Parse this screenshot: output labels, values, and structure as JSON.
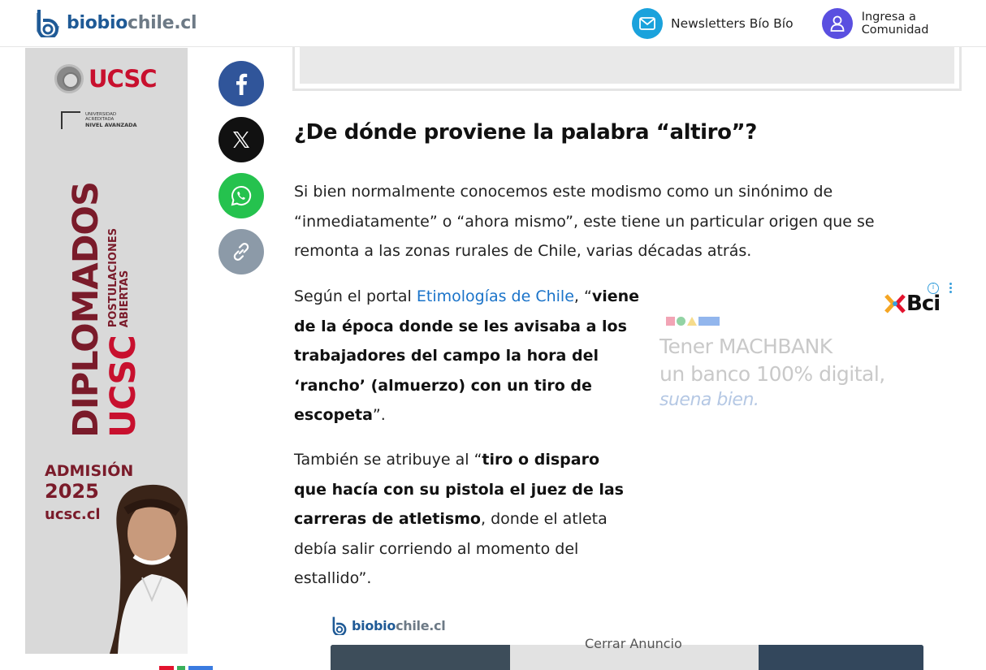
{
  "header": {
    "logo_part1": "biobio",
    "logo_part2": "chile.cl",
    "newsletters_label": "Newsletters Bío Bío",
    "community_label": "Ingresa a Comunidad"
  },
  "left_ad": {
    "brand": "UCSC",
    "accreditation_line1": "UNIVERSIDAD ACREDITADA",
    "accreditation_line2": "NIVEL AVANZADA",
    "headline": "DIPLOMADOS",
    "brand_vertical": "UCSC",
    "postulaciones_1": "POSTULACIONES",
    "postulaciones_2": "ABIERTAS",
    "admision": "ADMISIÓN",
    "year": "2025",
    "website": "ucsc.cl"
  },
  "share": {
    "items": [
      {
        "name": "facebook-icon"
      },
      {
        "name": "x-icon"
      },
      {
        "name": "whatsapp-icon"
      },
      {
        "name": "link-icon"
      }
    ]
  },
  "article": {
    "heading": "¿De dónde proviene la palabra “altiro”?",
    "p1": "Si bien normalmente conocemos este modismo como un sinónimo de “inmediatamente” o “ahora mismo”, este tiene un particular origen que se remonta a las zonas rurales de Chile, varias décadas atrás.",
    "p2_pre": "Según el portal ",
    "p2_link": "Etimologías de Chile",
    "p2_mid": ", “",
    "p2_bold": "viene de la época donde se les avisaba a los trabajadores del campo la hora del ‘rancho’ (almuerzo) con un tiro de escopeta",
    "p2_end": "”.",
    "p3_pre": "También se atribuye al “",
    "p3_bold": "tiro o disparo que hacía con su pistola el juez de las carreras de atletismo",
    "p3_end": ", donde el atleta debía salir corriendo al momento del estallido”."
  },
  "bci_ad": {
    "brand": "Bci",
    "line1": "Tener MACHBANK",
    "line2": "un banco 100% digital,",
    "line3": "suena bien."
  },
  "video": {
    "logo_part1": "biobio",
    "logo_part2": "chile.cl",
    "close_label": "Cerrar Anuncio"
  },
  "colors": {
    "brand_blue": "#1f5a96",
    "link_blue": "#1a73c9",
    "newsletter_circle": "#1aa2dc",
    "community_circle": "#5a4fe0",
    "ucsc_red": "#c8102e",
    "ucsc_maroon": "#7a1b2a"
  }
}
